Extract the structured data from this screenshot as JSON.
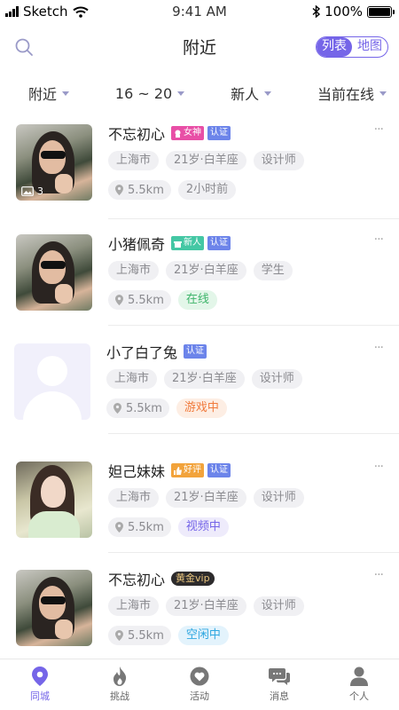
{
  "status_bar": {
    "carrier": "Sketch",
    "time": "9:41 AM",
    "battery": "100%"
  },
  "nav": {
    "title": "附近",
    "toggle_list": "列表",
    "toggle_map": "地图"
  },
  "filters": [
    {
      "label": "附近"
    },
    {
      "label": "16 ~ 20"
    },
    {
      "label": "新人"
    },
    {
      "label": "当前在线"
    }
  ],
  "users": [
    {
      "name": "不忘初心",
      "badges": [
        "女神",
        "认证"
      ],
      "tags": [
        "上海市",
        "21岁·白羊座",
        "设计师"
      ],
      "distance": "5.5km",
      "status": "2小时前",
      "photo_count": "3"
    },
    {
      "name": "小猪佩奇",
      "badges": [
        "新人",
        "认证"
      ],
      "tags": [
        "上海市",
        "21岁·白羊座",
        "学生"
      ],
      "distance": "5.5km",
      "status": "在线"
    },
    {
      "name": "小了白了兔",
      "badges": [
        "认证"
      ],
      "tags": [
        "上海市",
        "21岁·白羊座",
        "设计师"
      ],
      "distance": "5.5km",
      "status": "游戏中"
    },
    {
      "name": "妲己妹妹",
      "badges": [
        "好评",
        "认证"
      ],
      "tags": [
        "上海市",
        "21岁·白羊座",
        "设计师"
      ],
      "distance": "5.5km",
      "status": "视频中"
    },
    {
      "name": "不忘初心",
      "badges": [
        "黄金vip"
      ],
      "tags": [
        "上海市",
        "21岁·白羊座",
        "设计师"
      ],
      "distance": "5.5km",
      "status": "空闲中"
    }
  ],
  "more_label": "···",
  "tabs": [
    {
      "label": "同城",
      "icon": "location-pin-icon"
    },
    {
      "label": "挑战",
      "icon": "flame-icon"
    },
    {
      "label": "活动",
      "icon": "heart-icon"
    },
    {
      "label": "消息",
      "icon": "chat-bubbles-icon"
    },
    {
      "label": "个人",
      "icon": "person-icon"
    }
  ],
  "colors": {
    "accent": "#7565e8"
  }
}
